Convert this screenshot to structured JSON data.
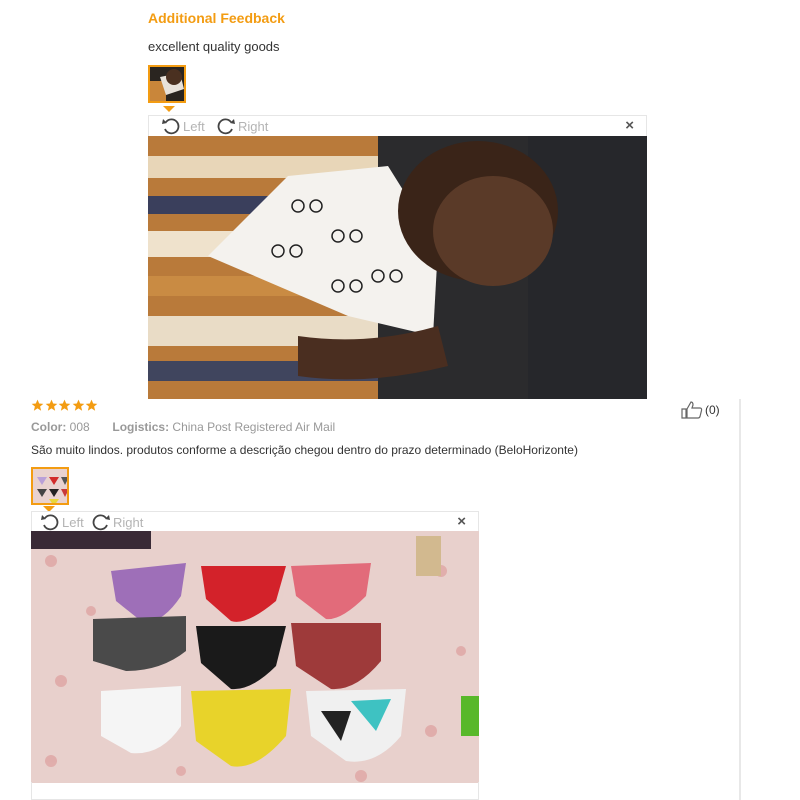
{
  "feedback1": {
    "heading": "Additional Feedback",
    "text": "excellent quality goods",
    "viewer": {
      "rotate_left": "Left",
      "rotate_right": "Right",
      "close": "×"
    }
  },
  "review2": {
    "rating": 5,
    "color_label": "Color:",
    "color_value": "008",
    "logistics_label": "Logistics:",
    "logistics_value": "China Post Registered Air Mail",
    "text": "São muito lindos. produtos conforme a descrição chegou dentro do prazo determinado (BeloHorizonte)",
    "likes": "(0)",
    "viewer": {
      "rotate_left": "Left",
      "rotate_right": "Right",
      "close": "×"
    }
  },
  "icons": {
    "star": "star-icon",
    "thumbs_up": "thumbs-up-icon",
    "rotate_left": "rotate-left-icon",
    "rotate_right": "rotate-right-icon",
    "close": "close-icon"
  },
  "colors": {
    "accent": "#f39c12",
    "muted": "#999999",
    "star": "#f39c12"
  }
}
